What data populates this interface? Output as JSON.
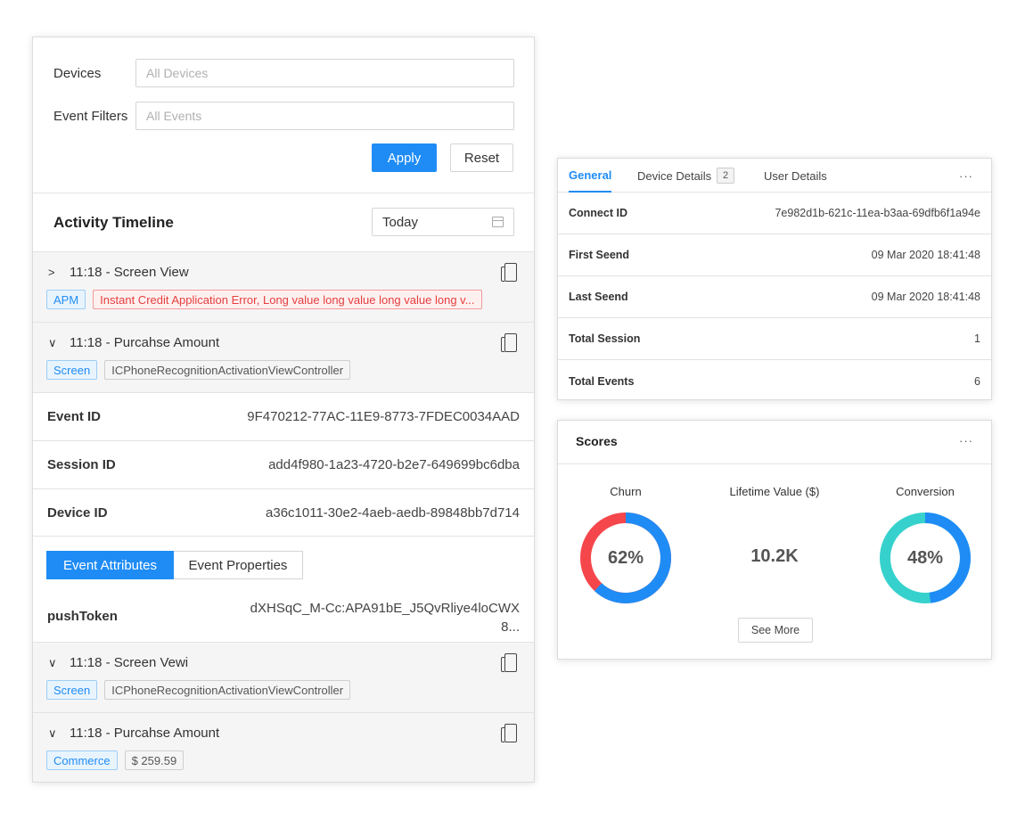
{
  "filters": {
    "devices_label": "Devices",
    "devices_placeholder": "All Devices",
    "event_filters_label": "Event Filters",
    "event_filters_placeholder": "All Events",
    "apply_label": "Apply",
    "reset_label": "Reset"
  },
  "timeline": {
    "title": "Activity Timeline",
    "date_range": "Today",
    "events": [
      {
        "chevron": ">",
        "title": "11:18 - Screen View",
        "tags": [
          "APM",
          "Instant Credit Application Error, Long value long value long value long v..."
        ]
      },
      {
        "chevron": "∨",
        "title": "11:18 - Purcahse Amount",
        "tags": [
          "Screen",
          "ICPhoneRecognitionActivationViewController"
        ]
      },
      {
        "chevron": "∨",
        "title": "11:18 - Screen Vewi",
        "tags": [
          "Screen",
          "ICPhoneRecognitionActivationViewController"
        ]
      },
      {
        "chevron": "∨",
        "title": "11:18 - Purcahse Amount",
        "tags": [
          "Commerce",
          "$ 259.59"
        ]
      }
    ],
    "details": [
      {
        "key": "Event ID",
        "value": "9F470212-77AC-11E9-8773-7FDEC0034AAD"
      },
      {
        "key": "Session ID",
        "value": "add4f980-1a23-4720-b2e7-649699bc6dba"
      },
      {
        "key": "Device ID",
        "value": "a36c1011-30e2-4aeb-aedb-89848bb7d714"
      }
    ],
    "segment": {
      "attributes": "Event Attributes",
      "properties": "Event Properties"
    },
    "push_token": {
      "key": "pushToken",
      "value": "dXHSqC_M-Cc:APA91bE_J5QvRliye4loCWX8..."
    }
  },
  "device_panel": {
    "tabs": {
      "general": "General",
      "device_details": "Device Details",
      "device_details_count": "2",
      "user_details": "User Details"
    },
    "more": "···",
    "rows": [
      {
        "key": "Connect ID",
        "value": "7e982d1b-621c-11ea-b3aa-69dfb6f1a94e"
      },
      {
        "key": "First Seend",
        "value": "09 Mar 2020 18:41:48"
      },
      {
        "key": "Last Seend",
        "value": "09 Mar 2020 18:41:48"
      },
      {
        "key": "Total Session",
        "value": "1"
      },
      {
        "key": "Total Events",
        "value": "6"
      }
    ]
  },
  "scores": {
    "title": "Scores",
    "more": "···",
    "churn": {
      "label": "Churn",
      "value_text": "62%",
      "value": 62,
      "arc_color": "#1f8cf5",
      "rest_color": "#f5474b"
    },
    "lifetime": {
      "label": "Lifetime Value ($)",
      "value_text": "10.2K"
    },
    "conversion": {
      "label": "Conversion",
      "value_text": "48%",
      "value": 48,
      "arc_color": "#1f8cf5",
      "rest_color": "#36d1cc"
    },
    "see_more": "See More"
  }
}
